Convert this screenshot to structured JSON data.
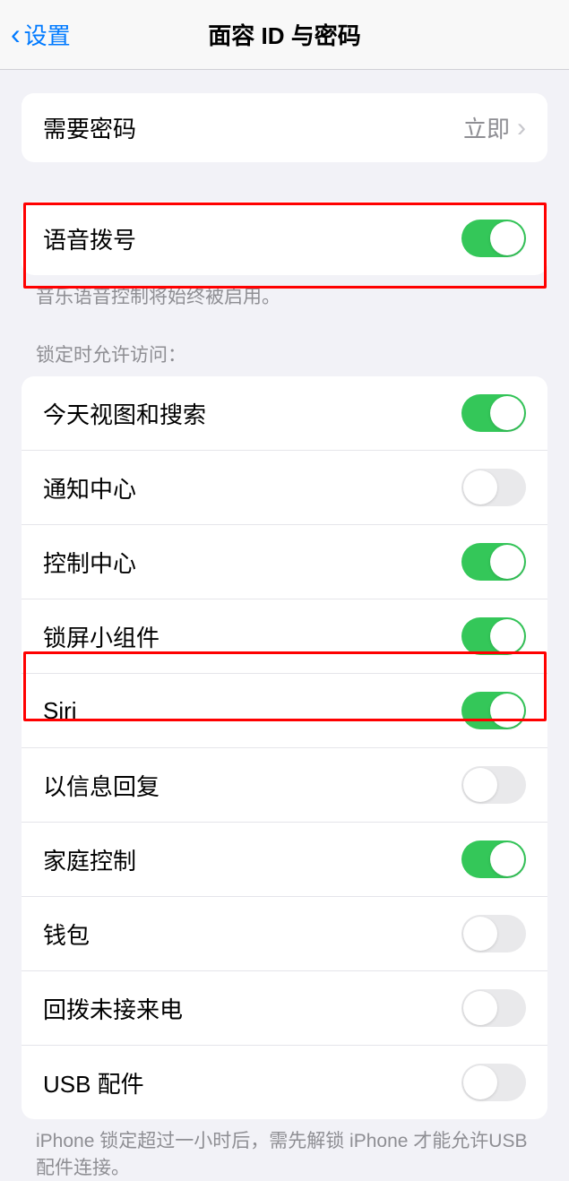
{
  "header": {
    "back_label": "设置",
    "title": "面容 ID 与密码"
  },
  "passcode_section": {
    "require_passcode_label": "需要密码",
    "require_passcode_value": "立即"
  },
  "voice_dial_section": {
    "voice_dial_label": "语音拨号",
    "voice_dial_on": true,
    "footer": "音乐语音控制将始终被启用。"
  },
  "lock_access_section": {
    "header": "锁定时允许访问：",
    "items": [
      {
        "label": "今天视图和搜索",
        "on": true
      },
      {
        "label": "通知中心",
        "on": false
      },
      {
        "label": "控制中心",
        "on": true
      },
      {
        "label": "锁屏小组件",
        "on": true
      },
      {
        "label": "Siri",
        "on": true
      },
      {
        "label": "以信息回复",
        "on": false
      },
      {
        "label": "家庭控制",
        "on": true
      },
      {
        "label": "钱包",
        "on": false
      },
      {
        "label": "回拨未接来电",
        "on": false
      },
      {
        "label": "USB 配件",
        "on": false
      }
    ],
    "footer": "iPhone 锁定超过一小时后，需先解锁 iPhone 才能允许USB 配件连接。"
  }
}
